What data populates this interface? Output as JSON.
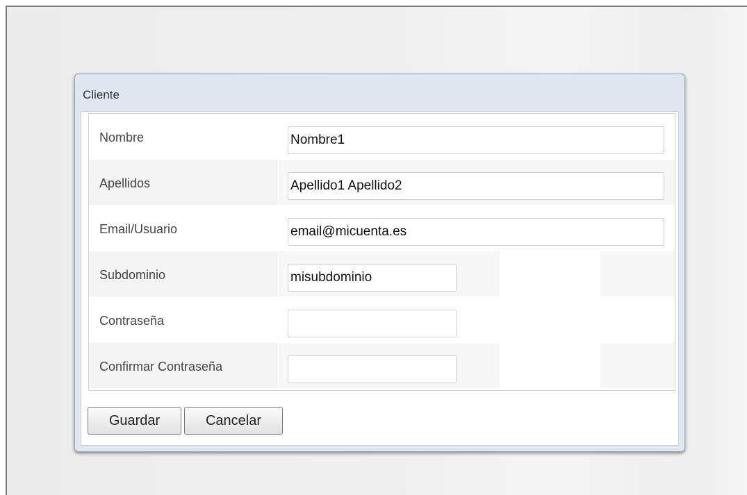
{
  "dialog": {
    "title": "Cliente"
  },
  "form": {
    "fields": [
      {
        "label": "Nombre",
        "value": "Nombre1",
        "placeholder": ""
      },
      {
        "label": "Apellidos",
        "value": "Apellido1 Apellido2",
        "placeholder": ""
      },
      {
        "label": "Email/Usuario",
        "value": "email@micuenta.es",
        "placeholder": ""
      },
      {
        "label": "Subdominio",
        "value": "misubdominio",
        "placeholder": ""
      },
      {
        "label": "Contraseña",
        "value": "",
        "placeholder": ""
      },
      {
        "label": "Confirmar Contraseña",
        "value": "",
        "placeholder": ""
      }
    ]
  },
  "buttons": {
    "save_label": "Guardar",
    "cancel_label": "Cancelar"
  }
}
